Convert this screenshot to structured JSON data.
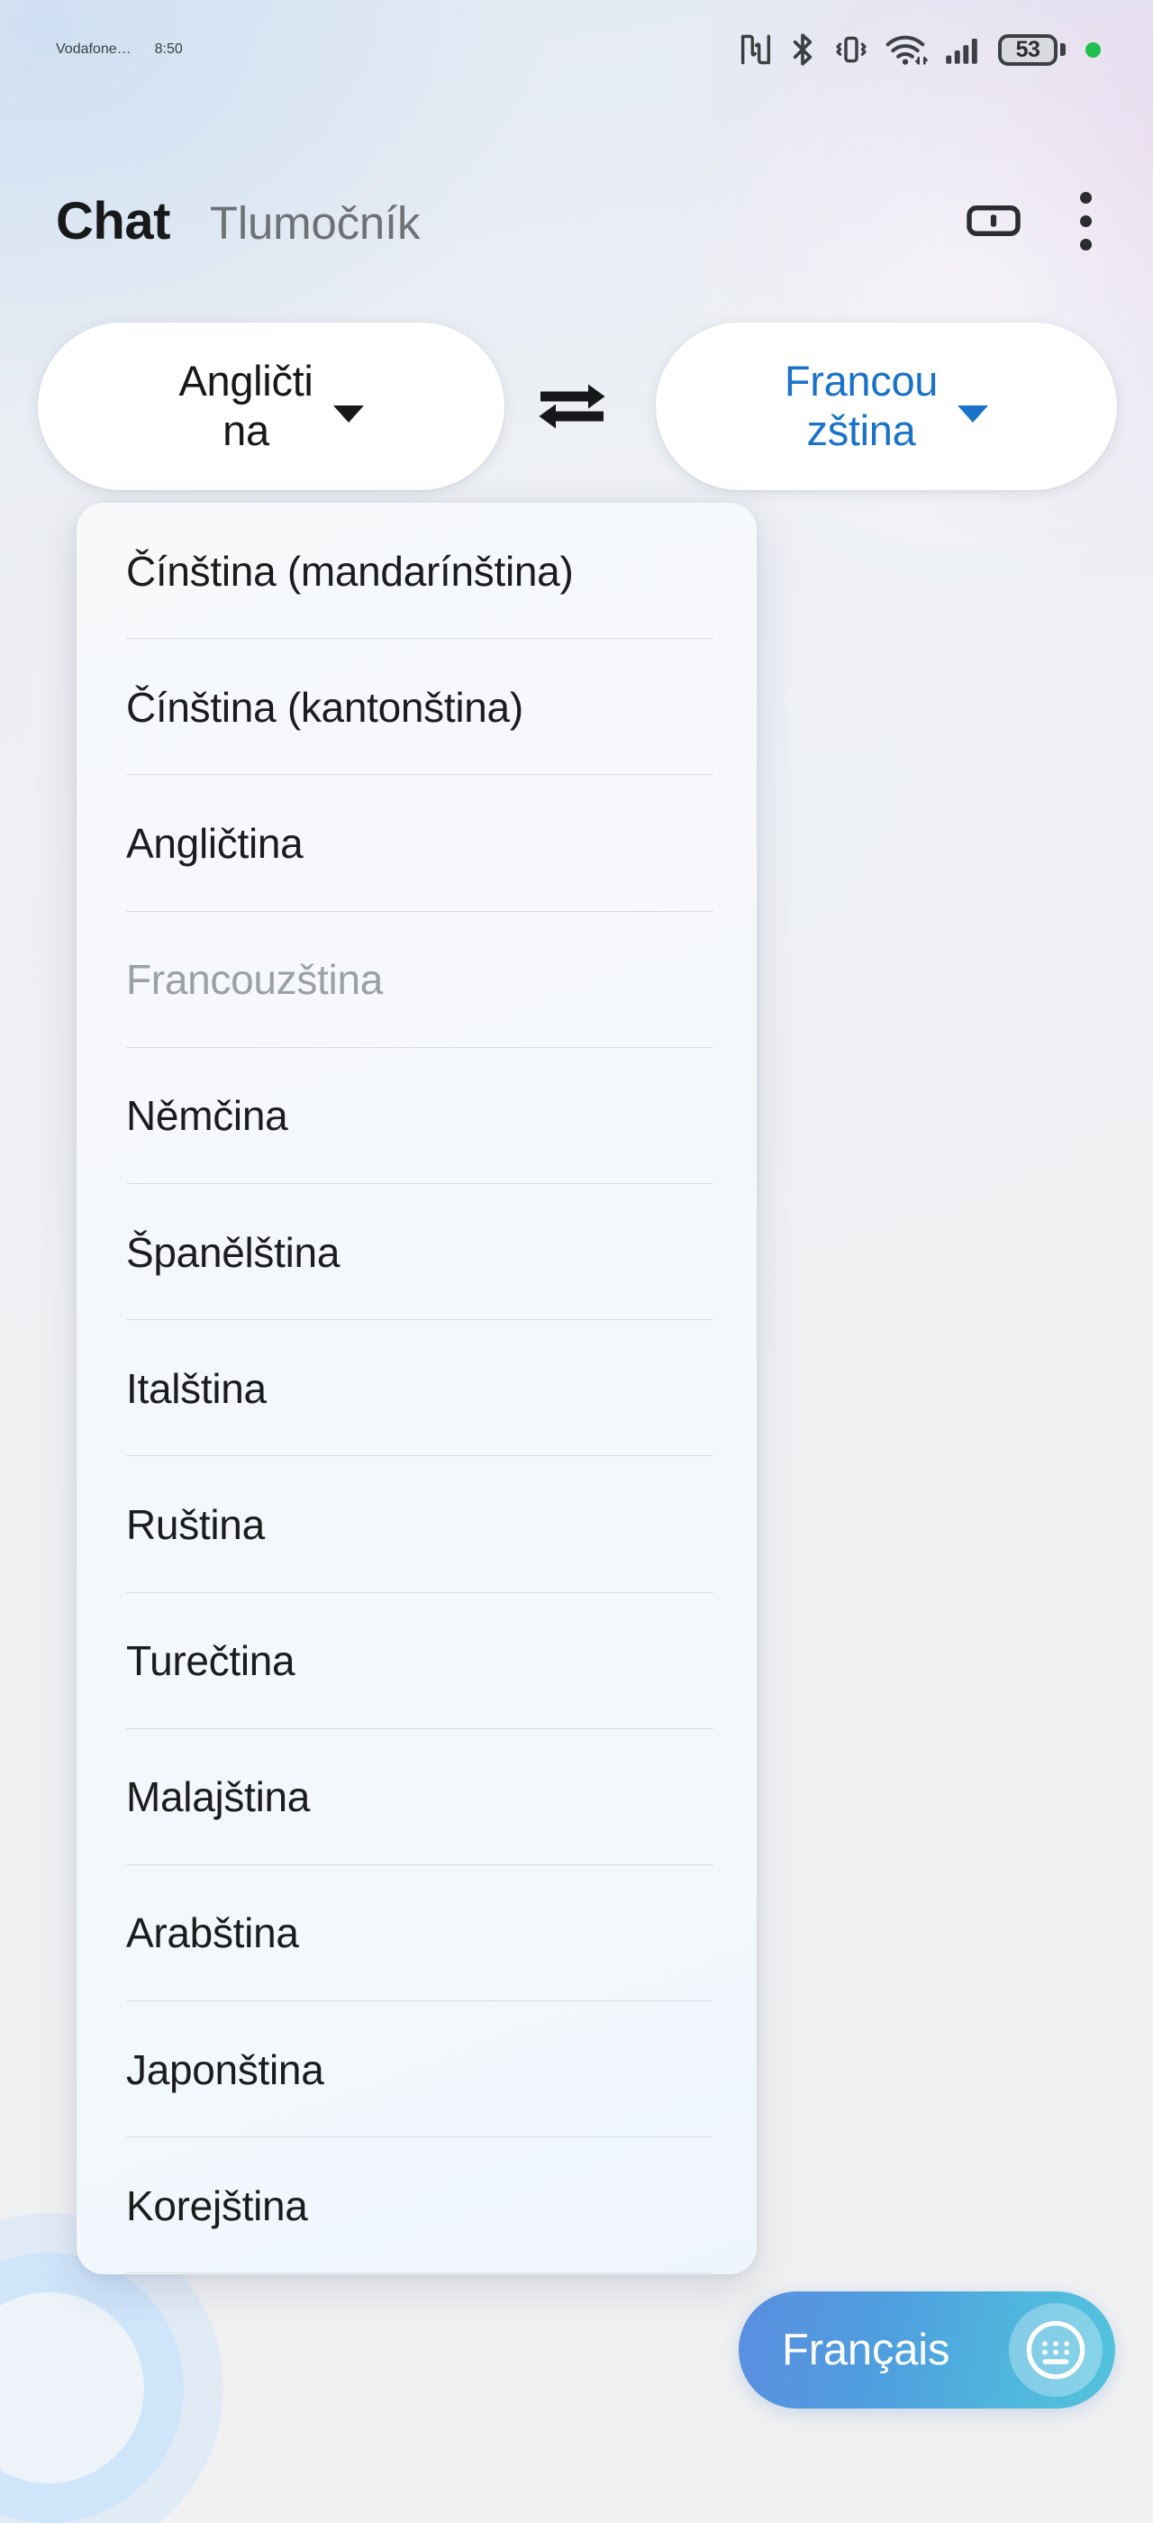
{
  "status_bar": {
    "carrier": "Vodafone…",
    "time": "8:50",
    "battery_percent": "53",
    "icons": [
      "nfc-icon",
      "bluetooth-icon",
      "vibrate-icon",
      "wifi-icon",
      "cellular-signal-icon",
      "battery-icon",
      "privacy-indicator-dot"
    ]
  },
  "header": {
    "tabs": [
      {
        "label": "Chat",
        "active": true
      },
      {
        "label": "Tlumočník",
        "active": false
      }
    ],
    "fullscreen_icon": "split-screen-icon",
    "overflow_icon": "more-vertical-icon"
  },
  "language_bar": {
    "source": {
      "label": "Angličtina",
      "line1": "Angličti",
      "line2": "na",
      "color": "#17181a"
    },
    "target": {
      "label": "Francouzština",
      "line1": "Francou",
      "line2": "zština",
      "color": "#1a73c7"
    },
    "swap_icon": "swap-horizontal-icon"
  },
  "dropdown": {
    "owner": "source",
    "items": [
      {
        "label": "Čínština (mandarínština)",
        "disabled": false
      },
      {
        "label": "Čínština (kantonština)",
        "disabled": false
      },
      {
        "label": "Angličtina",
        "disabled": false
      },
      {
        "label": "Francouzština",
        "disabled": true
      },
      {
        "label": "Němčina",
        "disabled": false
      },
      {
        "label": "Španělština",
        "disabled": false
      },
      {
        "label": "Italština",
        "disabled": false
      },
      {
        "label": "Ruština",
        "disabled": false
      },
      {
        "label": "Turečtina",
        "disabled": false
      },
      {
        "label": "Malajština",
        "disabled": false
      },
      {
        "label": "Arabština",
        "disabled": false
      },
      {
        "label": "Japonština",
        "disabled": false
      },
      {
        "label": "Korejština",
        "disabled": false
      }
    ]
  },
  "bottom_bar": {
    "target_input_label": "Français",
    "keyboard_icon": "keyboard-icon",
    "mic_icon": "microphone-icon"
  },
  "colors": {
    "accent_blue": "#1a73c7",
    "pill_gradient_start": "#5b8ee0",
    "pill_gradient_end": "#53c3dd",
    "disabled_text": "#9aa0a6",
    "background": "#eef1f4"
  }
}
